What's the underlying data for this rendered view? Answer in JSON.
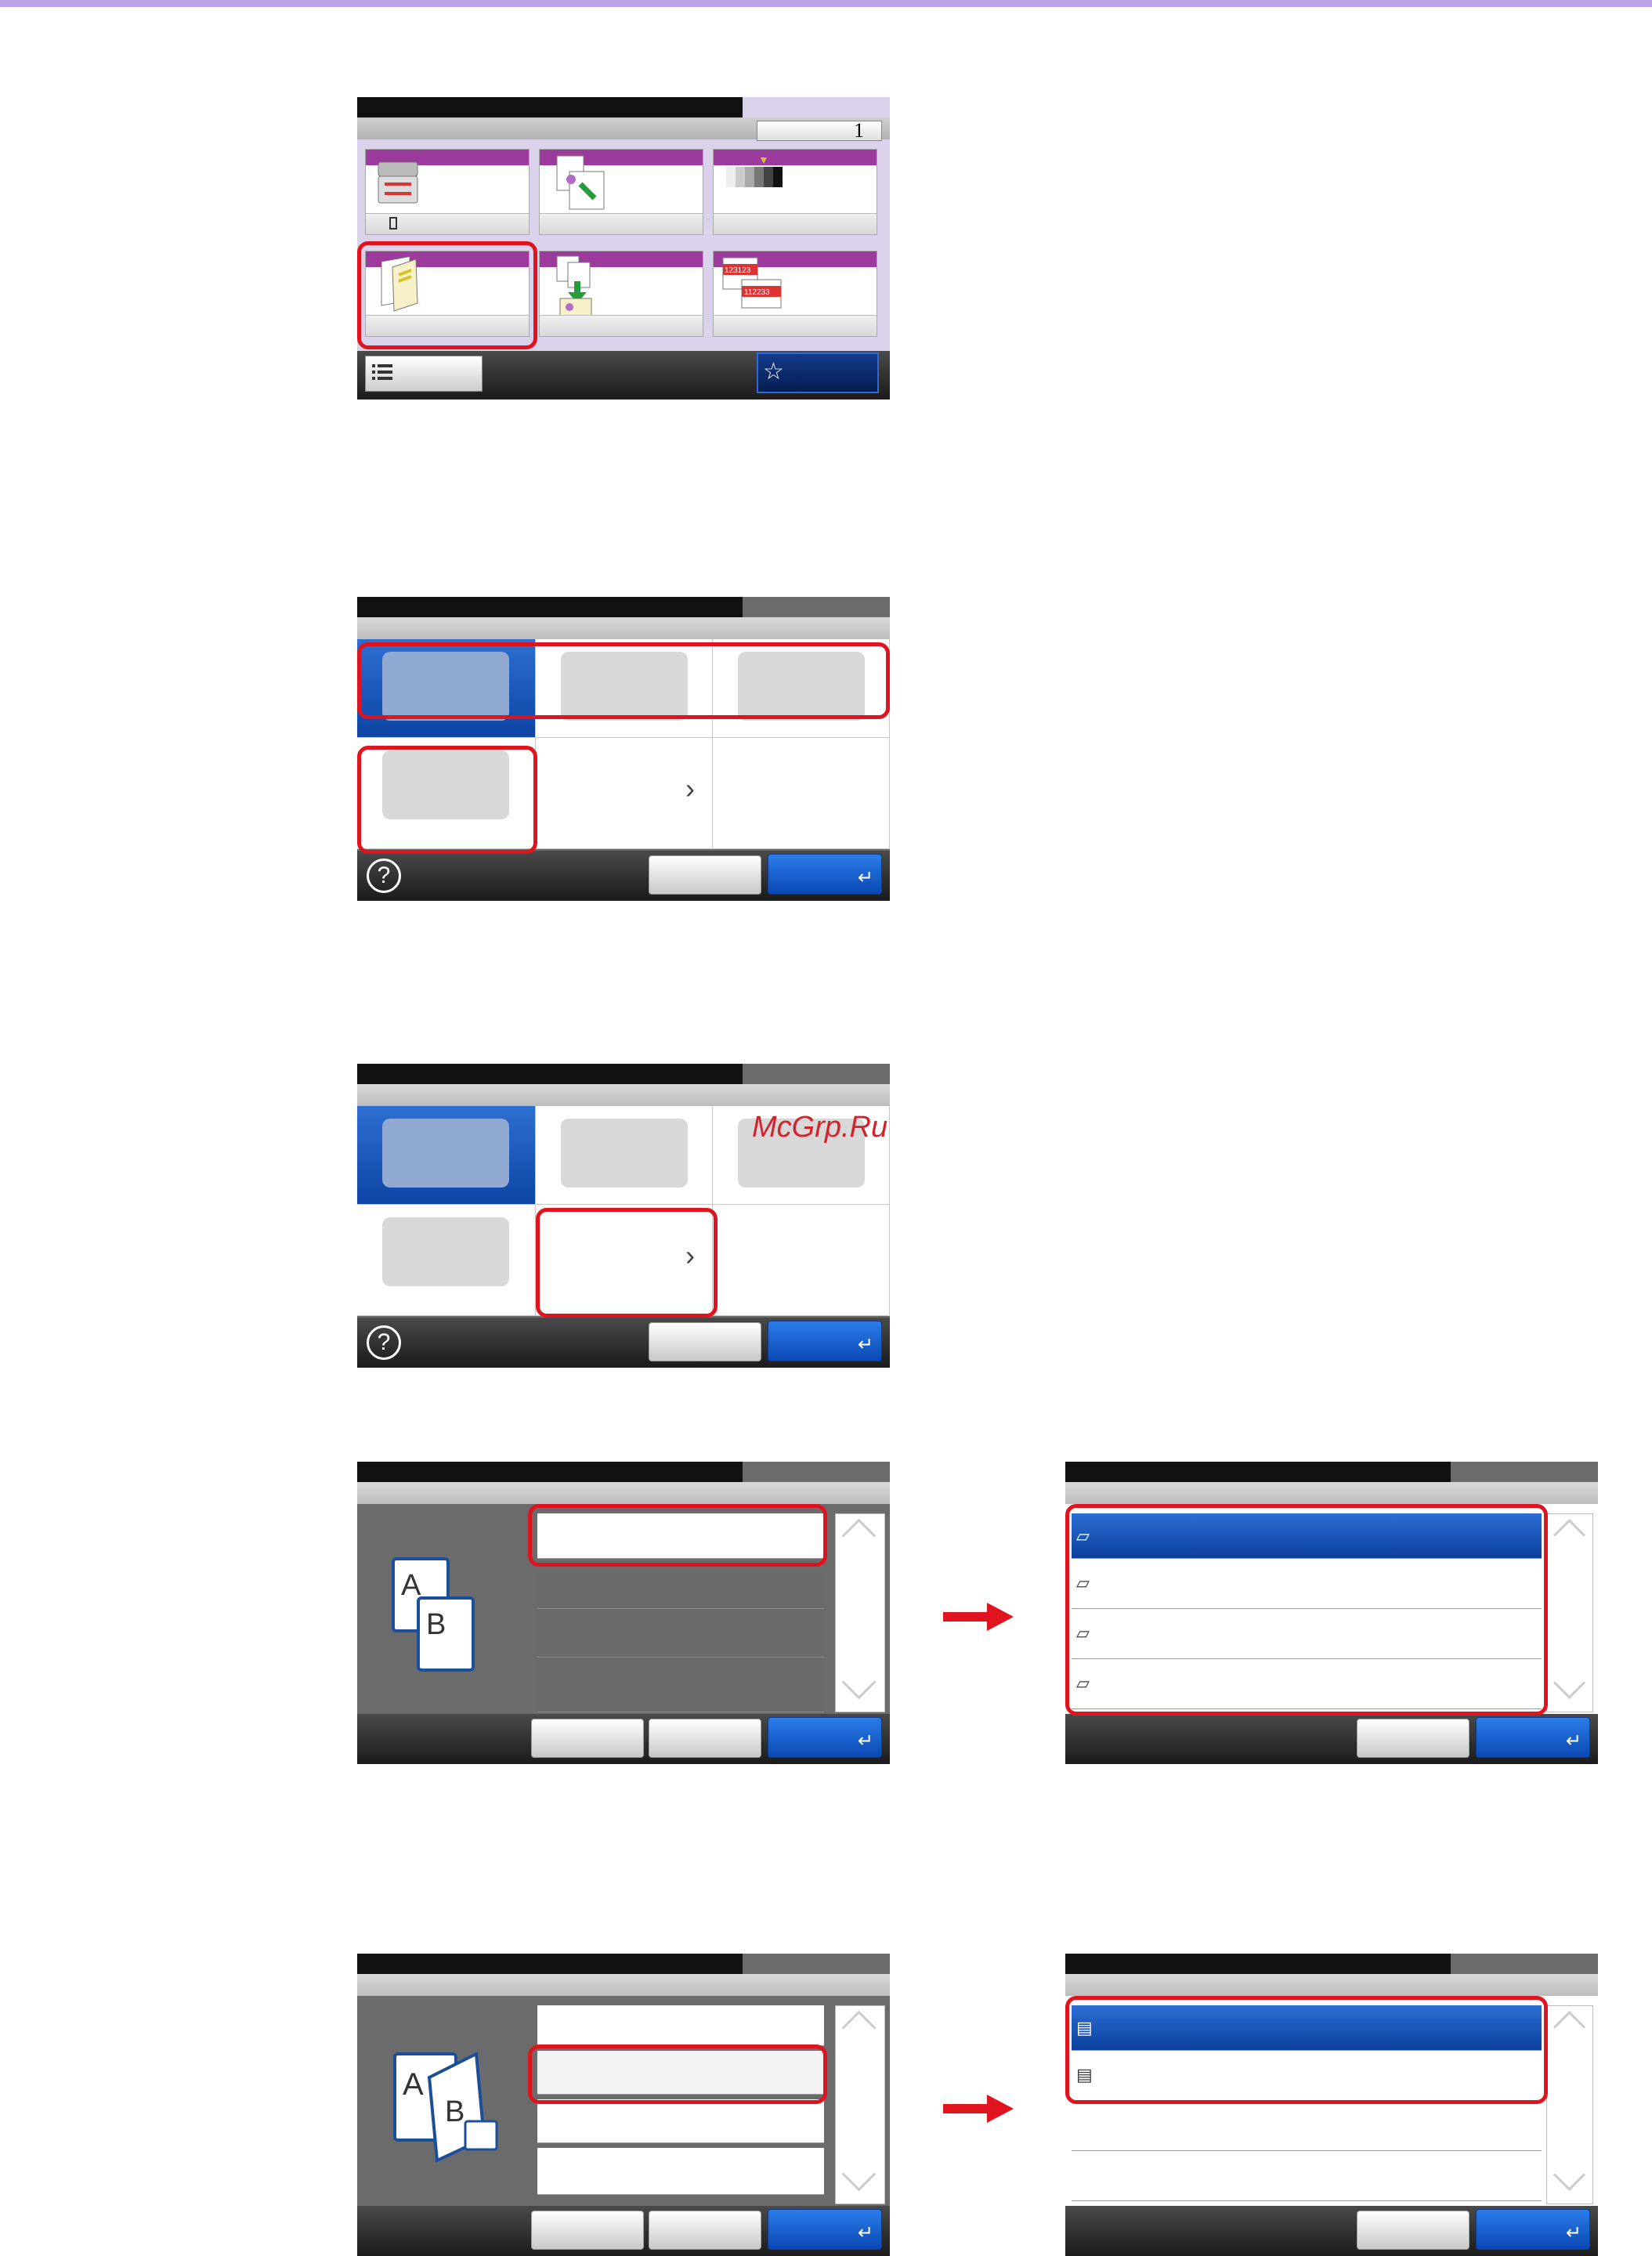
{
  "screen1": {
    "counter": "1",
    "icons": {
      "paper": "paper-select-icon",
      "zoom": "zoom-icon",
      "density": "density-icon",
      "duplex": "duplex-icon",
      "combine": "combine-icon",
      "collate": "collate-icon",
      "menu": "function-list-icon",
      "favorite": "star-icon"
    },
    "collate_labels": [
      "123123",
      "112233"
    ]
  },
  "duplex_screen": {
    "icons": [
      "1sided-to-1sided-icon",
      "1sided-to-2sided-icon",
      "2sided-to-1sided-icon",
      "2sided-to-2sided-icon"
    ]
  },
  "help_glyph": "?",
  "chevron_glyph": "›",
  "enter_glyph": "↵",
  "colors": {
    "accent_red": "#e0141e",
    "selected_blue": "#0d45a3",
    "tile_band_purple": "#9c3a9e",
    "top_band": "#b9a4e6"
  },
  "watermark": "McGrp.Ru"
}
